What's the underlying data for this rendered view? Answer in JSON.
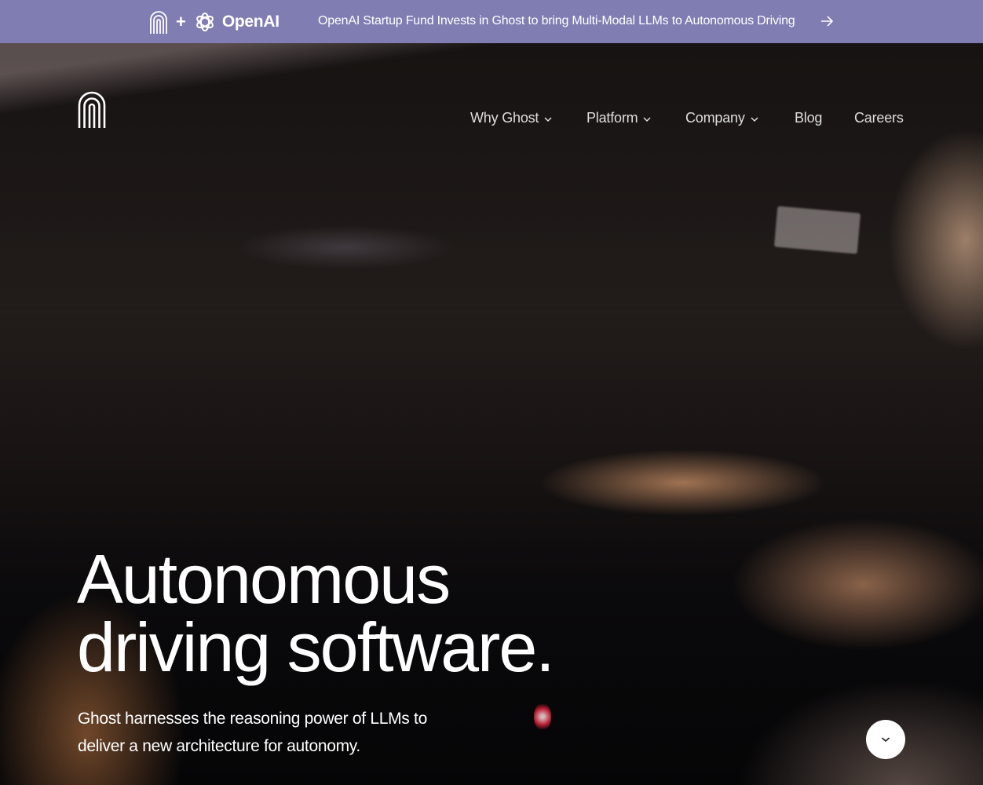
{
  "banner": {
    "brand_logo_icon": "ghost-logo-icon",
    "plus": "+",
    "partner_icon": "openai-logo-icon",
    "partner_name": "OpenAI",
    "headline": "OpenAI Startup Fund Invests in Ghost to bring Multi-Modal LLMs to Autonomous Driving",
    "arrow_icon": "arrow-right-icon",
    "background_color": "#7f7db2"
  },
  "nav": {
    "logo_icon": "ghost-logo-icon",
    "items": [
      {
        "label": "Why Ghost",
        "has_dropdown": true
      },
      {
        "label": "Platform",
        "has_dropdown": true
      },
      {
        "label": "Company",
        "has_dropdown": true
      },
      {
        "label": "Blog",
        "has_dropdown": false
      },
      {
        "label": "Careers",
        "has_dropdown": false
      }
    ]
  },
  "hero": {
    "title_line1": "Autonomous",
    "title_line2": "driving software.",
    "subtitle_line1": "Ghost harnesses the reasoning power of LLMs to",
    "subtitle_line2": "deliver a new architecture for autonomy.",
    "scroll_button_icon": "chevron-down-icon"
  }
}
